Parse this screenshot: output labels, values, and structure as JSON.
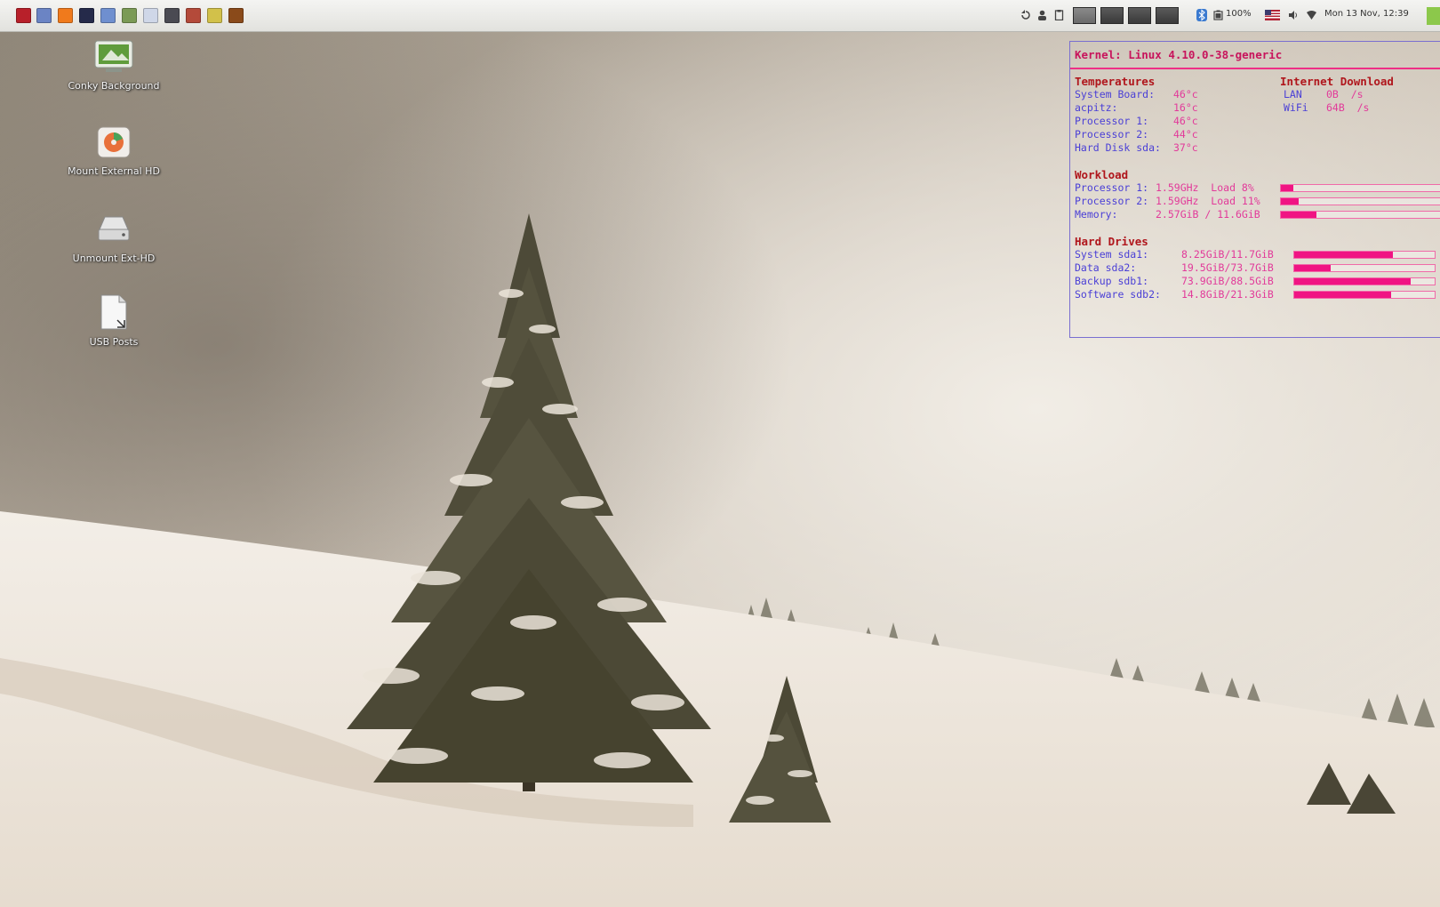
{
  "panel": {
    "launchers": [
      {
        "icon": "terminal-icon",
        "color": "#b8202a"
      },
      {
        "icon": "file-manager-icon",
        "color": "#6b84c4"
      },
      {
        "icon": "firefox-icon",
        "color": "#f07a1c"
      },
      {
        "icon": "app-icon",
        "color": "#252a4a"
      },
      {
        "icon": "folder-icon",
        "color": "#6f8fcf"
      },
      {
        "icon": "calculator-icon",
        "color": "#7b9a56"
      },
      {
        "icon": "text-editor-icon",
        "color": "#cfd7e8"
      },
      {
        "icon": "screenshot-icon",
        "color": "#4a4a52"
      },
      {
        "icon": "image-viewer-icon",
        "color": "#b44a3a"
      },
      {
        "icon": "leaf-icon",
        "color": "#d2c14a"
      },
      {
        "icon": "archive-icon",
        "color": "#8a4a1a"
      }
    ],
    "tray": {
      "battery": "100%",
      "clock": "Mon 13 Nov, 12:39"
    }
  },
  "desktop_icons": [
    {
      "name": "conky-background",
      "label": "Conky Background",
      "icon": "image-shortcut-icon"
    },
    {
      "name": "mount-external-hd",
      "label": "Mount External HD",
      "icon": "disk-utility-icon"
    },
    {
      "name": "unmount-ext-hd",
      "label": "Unmount Ext-HD",
      "icon": "drive-icon"
    },
    {
      "name": "usb-posts",
      "label": "USB Posts",
      "icon": "document-icon"
    }
  ],
  "conky": {
    "kernel": "Kernel: Linux 4.10.0-38-generic",
    "temperatures": {
      "heading": "Temperatures",
      "rows": [
        {
          "label": "System Board:",
          "value": "46°c"
        },
        {
          "label": "acpitz:",
          "value": "16°c"
        },
        {
          "label": "Processor 1:",
          "value": "46°c"
        },
        {
          "label": "Processor 2:",
          "value": "44°c"
        },
        {
          "label": "Hard Disk sda:",
          "value": "37°c"
        }
      ]
    },
    "internet": {
      "heading": "Internet Download",
      "rows": [
        {
          "label": "LAN",
          "value": "0B  /s"
        },
        {
          "label": "WiFi",
          "value": "64B  /s"
        }
      ]
    },
    "workload": {
      "heading": "Workload",
      "rows": [
        {
          "label": "Processor 1:",
          "value": "1.59GHz  Load 8%",
          "level": 0.08
        },
        {
          "label": "Processor 2:",
          "value": "1.59GHz  Load 11%",
          "level": 0.11
        },
        {
          "label": "Memory:",
          "value": "2.57GiB / 11.6GiB",
          "level": 0.22
        }
      ]
    },
    "drives": {
      "heading": "Hard Drives",
      "rows": [
        {
          "label": "System sda1:",
          "value": "8.25GiB/11.7GiB",
          "level": 0.7
        },
        {
          "label": "Data sda2:",
          "value": "19.5GiB/73.7GiB",
          "level": 0.26
        },
        {
          "label": "Backup sdb1:",
          "value": "73.9GiB/88.5GiB",
          "level": 0.83
        },
        {
          "label": "Software sdb2:",
          "value": "14.8GiB/21.3GiB",
          "level": 0.69
        }
      ]
    },
    "colors": {
      "heading": "#b0161c",
      "label": "#4a3fd6",
      "value": "#e23a9a",
      "bar": "#f01483"
    }
  }
}
